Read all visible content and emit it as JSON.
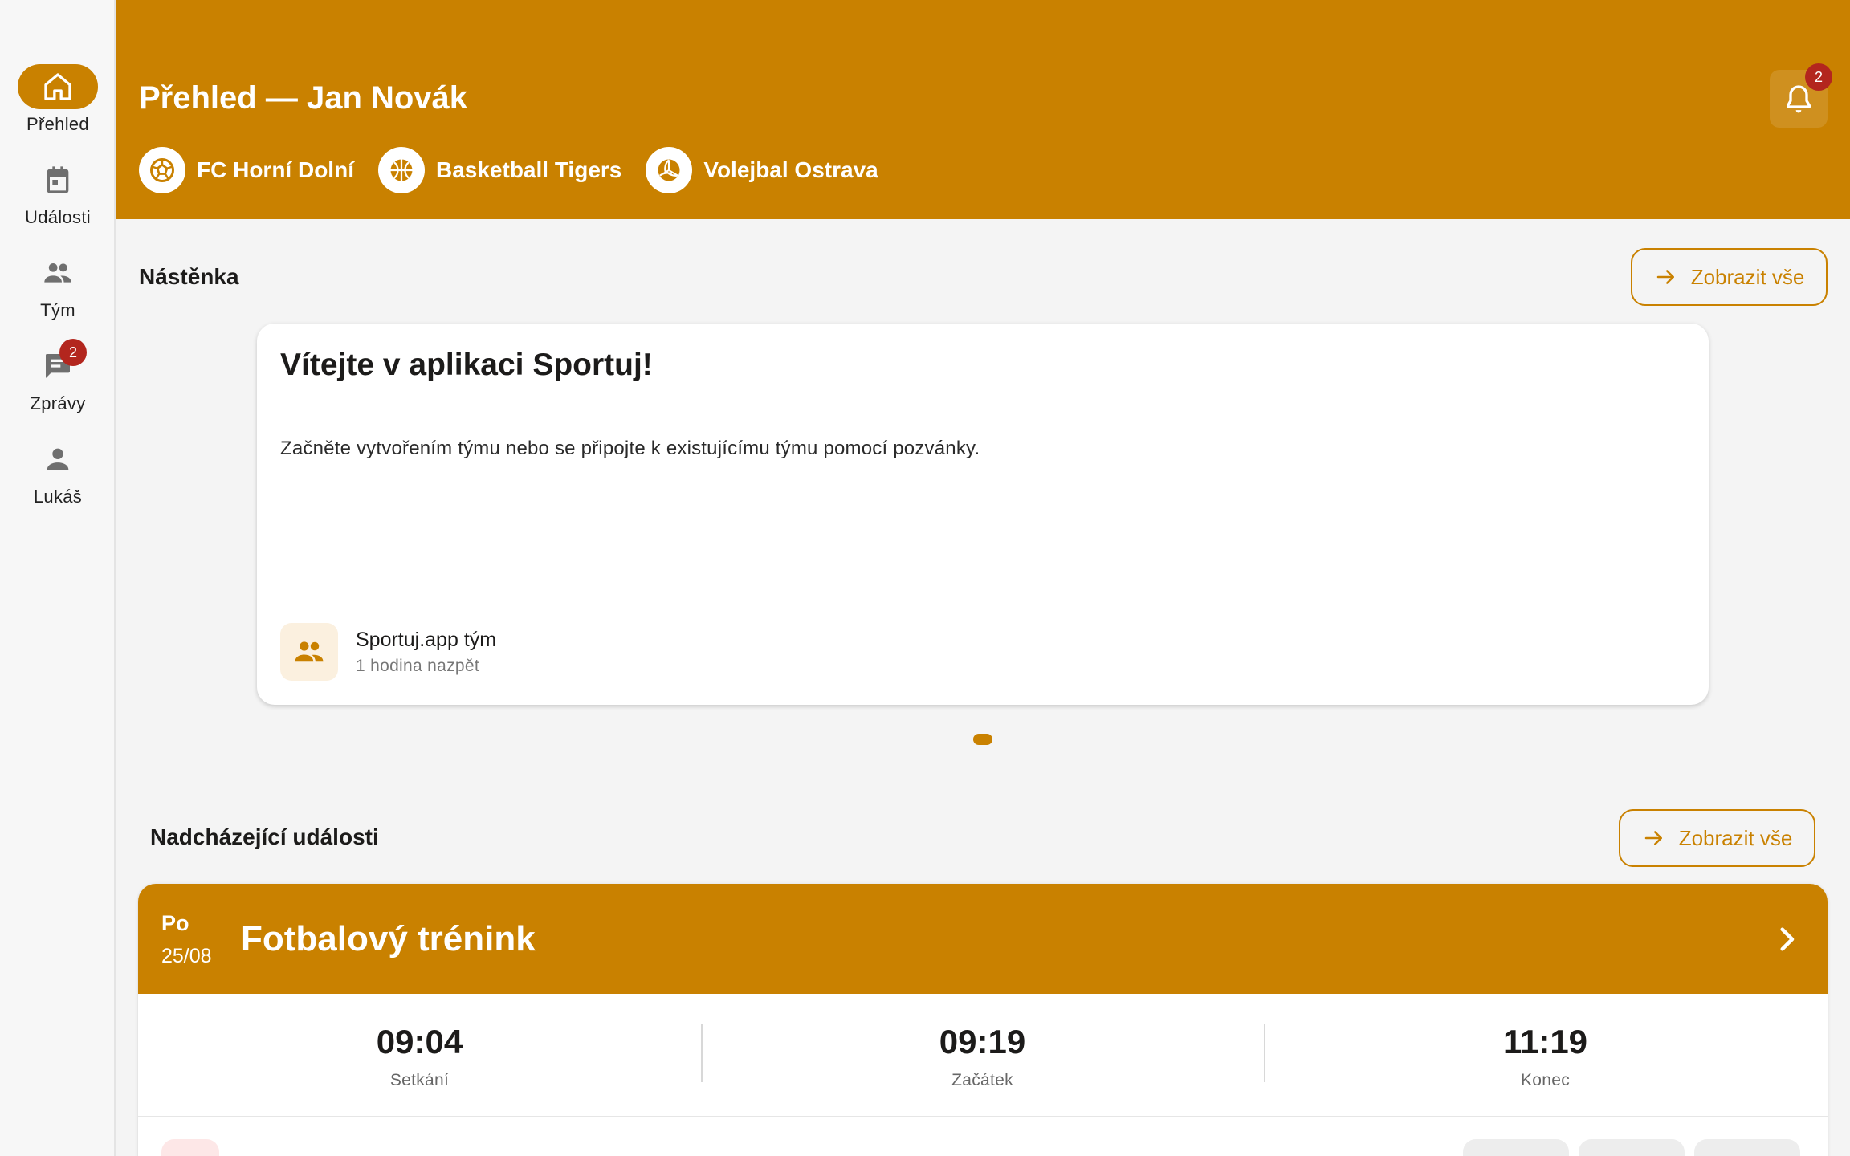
{
  "nav": {
    "items": [
      {
        "label": "Přehled",
        "icon": "home-icon",
        "active": true
      },
      {
        "label": "Události",
        "icon": "calendar-icon"
      },
      {
        "label": "Tým",
        "icon": "people-icon"
      },
      {
        "label": "Zprávy",
        "icon": "chat-icon",
        "badge": "2"
      },
      {
        "label": "Lukáš",
        "icon": "person-icon"
      }
    ]
  },
  "header": {
    "title": "Přehled — Jan Novák",
    "notifications_badge": "2",
    "teams": [
      {
        "name": "FC Horní Dolní",
        "icon": "soccer-ball-icon"
      },
      {
        "name": "Basketball Tigers",
        "icon": "basketball-icon"
      },
      {
        "name": "Volejbal Ostrava",
        "icon": "volleyball-icon"
      }
    ]
  },
  "board": {
    "section_title": "Nástěnka",
    "show_all_label": "Zobrazit vše",
    "post": {
      "title": "Vítejte v aplikaci Sportuj!",
      "text": "Začněte vytvořením týmu nebo se připojte k existujícímu týmu pomocí pozvánky.",
      "author": "Sportuj.app tým",
      "time": "1 hodina nazpět"
    }
  },
  "events": {
    "section_title": "Nadcházející události",
    "show_all_label": "Zobrazit vše",
    "items": [
      {
        "day": "Po",
        "date": "25/08",
        "title": "Fotbalový trénink",
        "times": [
          {
            "value": "09:04",
            "label": "Setkání"
          },
          {
            "value": "09:19",
            "label": "Začátek"
          },
          {
            "value": "11:19",
            "label": "Konec"
          }
        ]
      }
    ]
  },
  "colors": {
    "primary": "#c98100",
    "badge": "#b3261e",
    "background": "#f4f4f4"
  }
}
